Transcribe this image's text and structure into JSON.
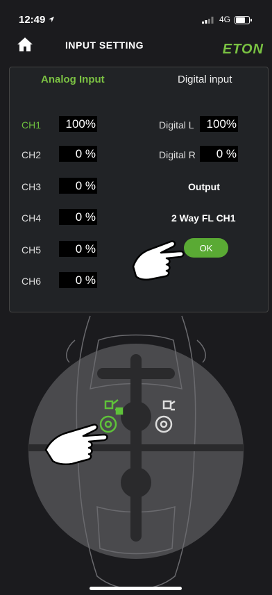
{
  "status": {
    "time": "12:49",
    "network": "4G"
  },
  "header": {
    "title": "INPUT SETTING",
    "logo": "ETON"
  },
  "tabs": {
    "analog": "Analog Input",
    "digital": "Digital input"
  },
  "channels": [
    {
      "label": "CH1",
      "value": "100%"
    },
    {
      "label": "CH2",
      "value": "0 %"
    },
    {
      "label": "CH3",
      "value": "0 %"
    },
    {
      "label": "CH4",
      "value": "0 %"
    },
    {
      "label": "CH5",
      "value": "0 %"
    },
    {
      "label": "CH6",
      "value": "0 %"
    }
  ],
  "digital": {
    "left_label": "Digital L",
    "left_value": "100%",
    "right_label": "Digital R",
    "right_value": "0 %"
  },
  "output": {
    "heading": "Output",
    "value": "2 Way FL CH1",
    "ok_label": "OK"
  },
  "colors": {
    "accent": "#7bc143",
    "ok_button": "#5aaa34",
    "background": "#1b1b1e"
  },
  "icons": [
    "location-arrow-icon",
    "signal-icon",
    "battery-icon",
    "home-icon",
    "pointing-hand-icon",
    "speaker-icon"
  ]
}
